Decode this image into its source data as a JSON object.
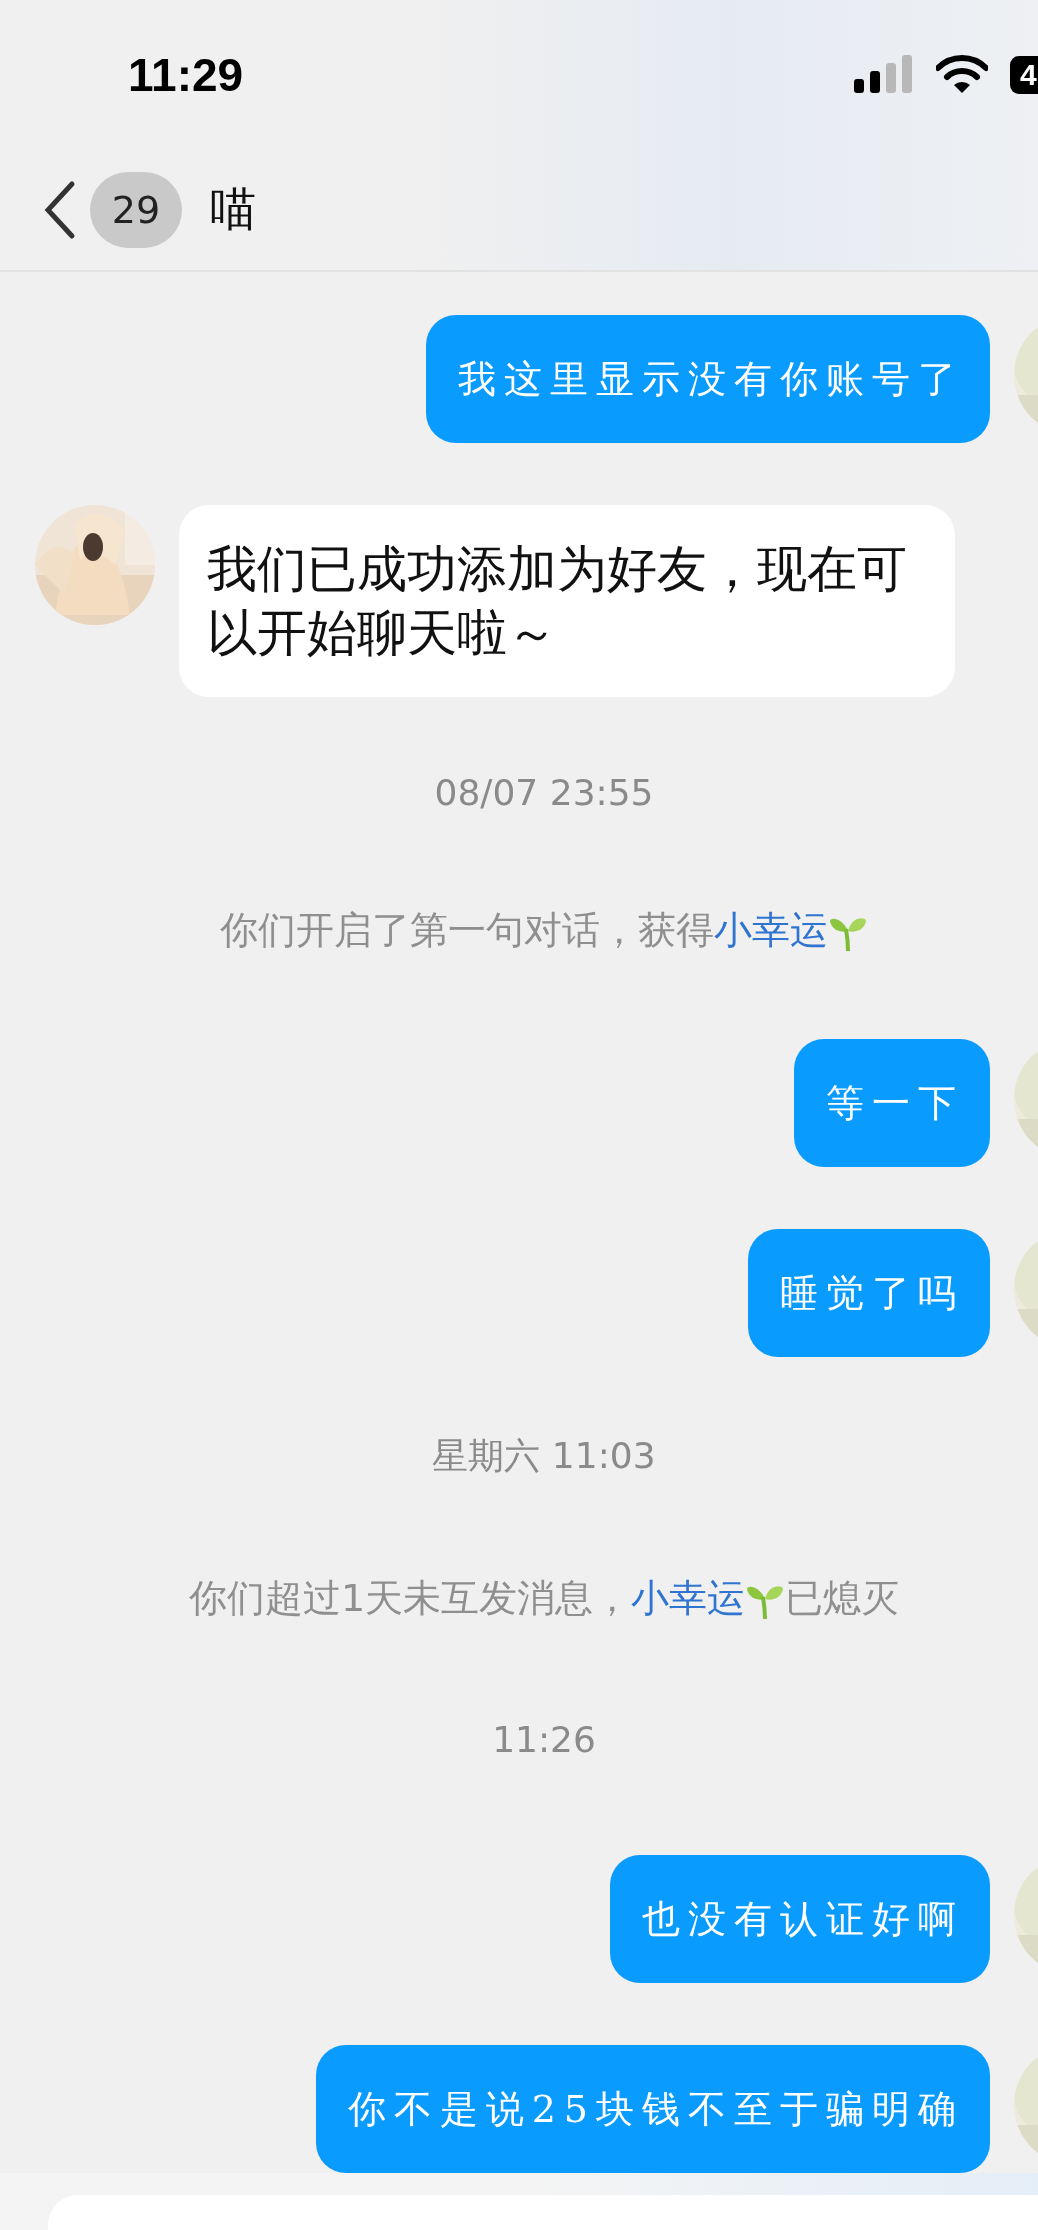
{
  "status_bar": {
    "time": "11:29",
    "battery": "4"
  },
  "nav": {
    "unread": "29",
    "title": "喵"
  },
  "messages": [
    {
      "kind": "outgoing",
      "text": "我这里显示没有你账号了"
    },
    {
      "kind": "incoming",
      "text": "我们已成功添加为好友，现在可以开始聊天啦～"
    },
    {
      "kind": "timestamp",
      "text": "08/07 23:55"
    },
    {
      "kind": "system",
      "before": "你们开启了第一句对话，获得",
      "link": "小幸运"
    },
    {
      "kind": "outgoing",
      "text": "等一下"
    },
    {
      "kind": "outgoing",
      "text": "睡觉了吗"
    },
    {
      "kind": "timestamp",
      "text": "星期六 11:03"
    },
    {
      "kind": "system",
      "before": "你们超过1天未互发消息，",
      "link": "小幸运",
      "after": "已熄灭"
    },
    {
      "kind": "timestamp",
      "text": "11:26"
    },
    {
      "kind": "outgoing",
      "text": "也没有认证好啊"
    },
    {
      "kind": "outgoing",
      "text": "你不是说25块钱不至于骗明确"
    }
  ]
}
